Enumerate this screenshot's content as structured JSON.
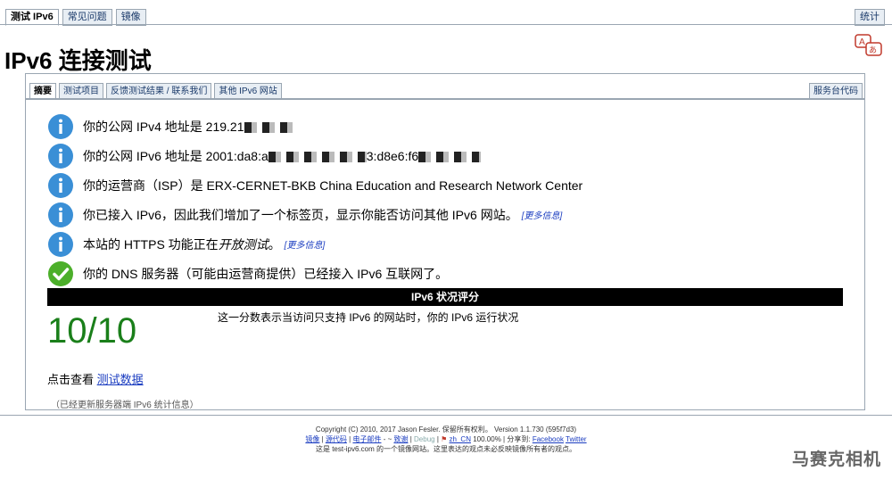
{
  "top_tabs": [
    "测试 IPv6",
    "常见问题",
    "镜像"
  ],
  "stats_tab": "统计",
  "title": "IPv6 连接测试",
  "sub_tabs": [
    "摘要",
    "测试项目",
    "反馈测试结果 / 联系我们",
    "其他 IPv6 网站"
  ],
  "helpdesk_tab": "服务台代码",
  "rows": [
    {
      "icon": "info-icon",
      "text": "你的公网 IPv4 地址是 219.21"
    },
    {
      "icon": "info-icon",
      "text": "你的公网 IPv6 地址是 2001:da8:a"
    },
    {
      "icon": "info-icon",
      "text": "你的运营商（ISP）是 ERX-CERNET-BKB China Education and Research Network Center"
    },
    {
      "icon": "info-icon",
      "text": "你已接入 IPv6，因此我们增加了一个标签页，显示你能否访问其他 IPv6 网站。",
      "more": "[更多信息]"
    },
    {
      "icon": "info-icon",
      "text": "本站的 HTTPS 功能正在",
      "em": "开放测试",
      "tail": "。",
      "more": "[更多信息]"
    },
    {
      "icon": "check-icon",
      "text": "你的 DNS 服务器（可能由运营商提供）已经接入 IPv6 互联网了。"
    }
  ],
  "ipv6_mid": "3:d8e6:f6",
  "score_header": "IPv6 状况评分",
  "score": "10/10",
  "score_desc": "这一分数表示当访问只支持 IPv6 的网站时，你的 IPv6 运行状况",
  "view_label": "点击查看",
  "view_link": "测试数据",
  "note": "（已经更新服务器端 IPv6 统计信息）",
  "footer": {
    "line1": "Copyright (C) 2010, 2017 Jason Fesler. 保留所有权利。 Version 1.1.730 (595f7d3)",
    "links": [
      "镜像",
      "源代码",
      "电子邮件",
      "致谢",
      "Debug",
      "zh_CN",
      "Facebook",
      "Twitter"
    ],
    "percent": "100.00%",
    "share": "分享到:",
    "line3": "这是 test-ipv6.com 的一个镜像网站。这里表达的观点未必反映镜像所有者的观点。"
  },
  "watermark": "马赛克相机",
  "colors": {
    "score": "#1a7f1a",
    "info": "#3a8fd6",
    "check": "#4caf2a"
  }
}
